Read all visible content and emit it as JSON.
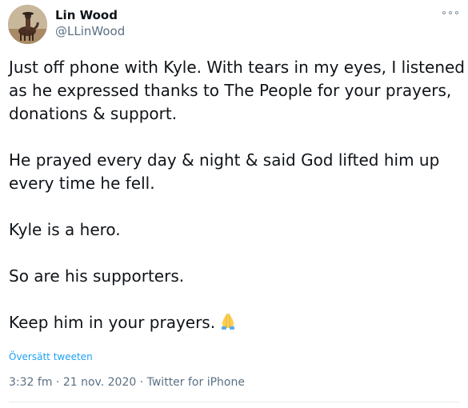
{
  "author": {
    "name": "Lin Wood",
    "handle": "@LLinWood"
  },
  "tweet": {
    "text": "Just off phone with Kyle. With tears in my eyes, I listened as he expressed thanks to The People for your prayers, donations & support.\n\nHe prayed every day & night & said God lifted him up every time he fell.\n\nKyle is a hero.\n\nSo are his supporters.\n\nKeep him in your prayers.",
    "emoji": "folded-hands-icon"
  },
  "translate_label": "Översätt tweeten",
  "meta": {
    "time": "3:32 fm",
    "separator": " · ",
    "date": "21 nov. 2020",
    "source": "Twitter for iPhone"
  },
  "colors": {
    "link": "#1da1f2",
    "muted": "#5b7083",
    "text": "#0f1419"
  }
}
